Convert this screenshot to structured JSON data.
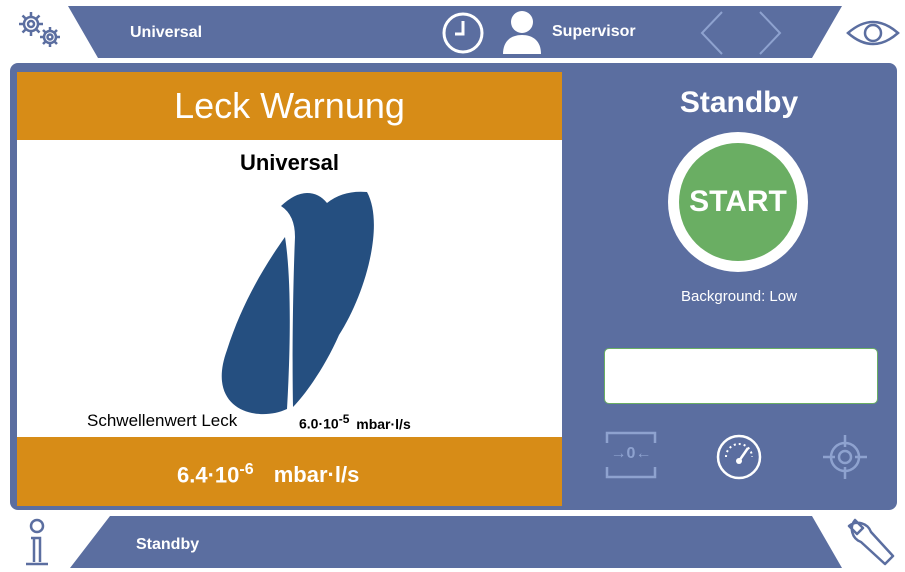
{
  "header": {
    "mode_label": "Universal",
    "user_label": "Supervisor"
  },
  "alarm": {
    "title": "Leck Warnung",
    "mode_name": "Universal",
    "threshold_label": "Schwellenwert Leck",
    "threshold_mantissa": "6.0·10",
    "threshold_exponent": "-5",
    "threshold_unit": "mbar·l/s",
    "reading_mantissa": "6.4·10",
    "reading_exponent": "-6",
    "reading_unit": "mbar·l/s"
  },
  "control": {
    "status": "Standby",
    "start_label": "START",
    "background_text": "Background: Low",
    "zero_label": "→0←"
  },
  "footer": {
    "status": "Standby"
  },
  "colors": {
    "header_bg": "#5b6ea0",
    "alarm_orange": "#d78c17",
    "start_green": "#6aae63",
    "logo_blue": "#254f80"
  },
  "icons": [
    "settings-gears-icon",
    "clock-icon",
    "user-icon",
    "back-chevron-icon",
    "forward-chevron-icon",
    "eye-icon",
    "zero-icon",
    "gauge-icon",
    "target-icon",
    "info-icon",
    "wrench-icon"
  ]
}
